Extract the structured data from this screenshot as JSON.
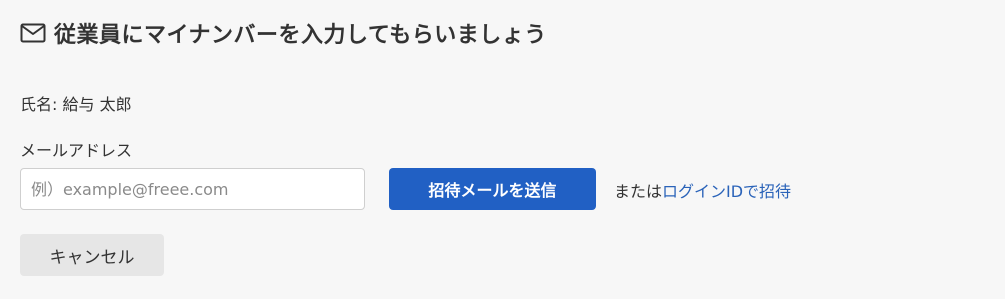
{
  "header": {
    "icon": "mail-icon",
    "title": "従業員にマイナンバーを入力してもらいましょう"
  },
  "employee": {
    "name_line": "氏名: 給与 太郎"
  },
  "email": {
    "label": "メールアドレス",
    "placeholder": "例）example@freee.com",
    "value": ""
  },
  "actions": {
    "send_label": "招待メールを送信",
    "or_text": "または",
    "login_link_label": "ログインIDで招待",
    "cancel_label": "キャンセル"
  },
  "colors": {
    "primary_button": "#2160c4",
    "link": "#2a63b9",
    "background": "#f7f7f7",
    "secondary_button": "#e6e6e6"
  }
}
